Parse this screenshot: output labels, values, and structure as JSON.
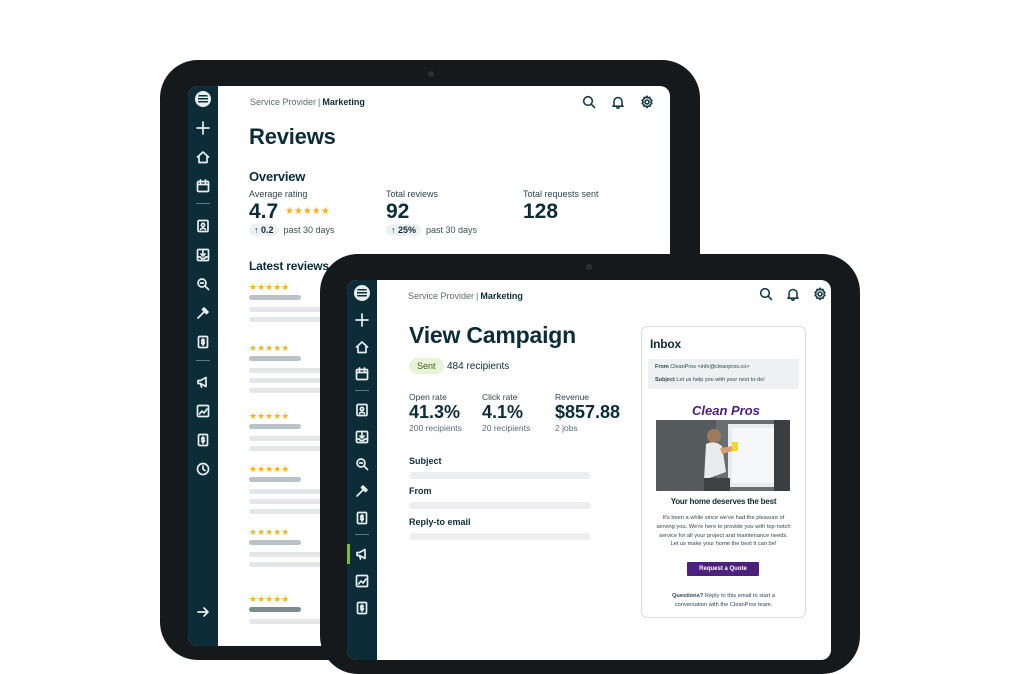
{
  "back": {
    "breadcrumb": {
      "section": "Service Provider",
      "page": "Marketing"
    },
    "title": "Reviews",
    "overview_heading": "Overview",
    "stats": [
      {
        "label": "Average rating",
        "value": "4.7",
        "stars": "★★★★★",
        "delta": "↑ 0.2",
        "period": "past 30 days"
      },
      {
        "label": "Total reviews",
        "value": "92",
        "delta": "↑ 25%",
        "period": "past 30 days"
      },
      {
        "label": "Total requests sent",
        "value": "128"
      }
    ],
    "latest_heading": "Latest reviews",
    "review_stars": [
      "★★★★★",
      "★★★★★",
      "★★★★★",
      "★★★★★",
      "★★★★★",
      "★★★★★"
    ]
  },
  "front": {
    "breadcrumb": {
      "section": "Service Provider",
      "page": "Marketing"
    },
    "title": "View Campaign",
    "status": "Sent",
    "recipients": "484 recipients",
    "metrics": [
      {
        "label": "Open rate",
        "value": "41.3%",
        "sub": "200 recipients"
      },
      {
        "label": "Click rate",
        "value": "4.1%",
        "sub": "20 recipients"
      },
      {
        "label": "Revenue",
        "value": "$857.88",
        "sub": "2 jobs"
      }
    ],
    "fields": [
      "Subject",
      "From",
      "Reply-to email"
    ],
    "inbox": {
      "title": "Inbox",
      "from_label": "From",
      "from_value": "CleanPros <info@cleanpros.co>",
      "subject_label": "Subject",
      "subject_value": "Let us help you with your next to-do!",
      "brand": "Clean Pros",
      "headline": "Your home deserves the best",
      "body": "It's been a while since we've had the pleasure of serving you. We're here to provide you with top-notch service for all your project and maintenance needs. Let us make your home the best it can be!",
      "cta": "Request a Quote",
      "footer_bold": "Questions?",
      "footer": " Reply to this email to start a conversation with the CleanPros team."
    }
  },
  "colors": {
    "sidebar": "#0c2c38",
    "star": "#f2b51c",
    "accent_purple": "#4d1f7e",
    "sent_bg": "#e6f3d6"
  },
  "icons": [
    "logo-icon",
    "plus-icon",
    "home-icon",
    "calendar-icon",
    "contacts-icon",
    "inbox-tray-icon",
    "search-map-icon",
    "hammer-icon",
    "invoice-icon",
    "megaphone-icon",
    "chart-icon",
    "dollar-icon",
    "clock-icon",
    "arrow-right-icon",
    "search-icon",
    "bell-icon",
    "gear-icon"
  ]
}
